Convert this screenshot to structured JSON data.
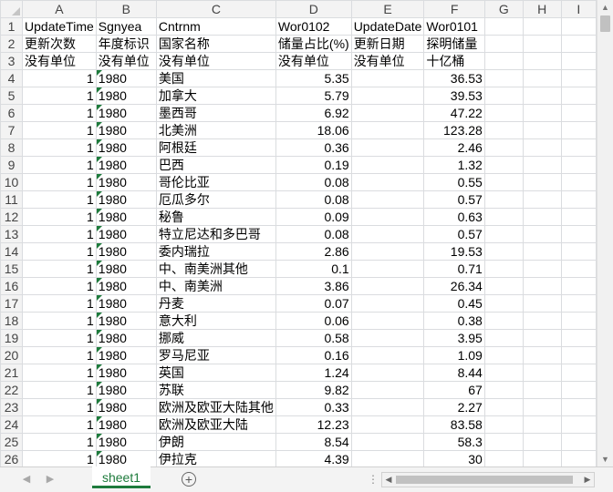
{
  "columns": [
    "A",
    "B",
    "C",
    "D",
    "E",
    "F",
    "G",
    "H",
    "I"
  ],
  "rows": [
    {
      "num": "1",
      "a": "UpdateTime",
      "b": "Sgnyea",
      "c": "Cntrnm",
      "d": "Wor0102",
      "e": "UpdateDate",
      "f": "Wor0101"
    },
    {
      "num": "2",
      "a": "更新次数",
      "b": "年度标识",
      "c": "国家名称",
      "d": "储量占比(%)",
      "e": "更新日期",
      "f": "探明储量"
    },
    {
      "num": "3",
      "a": "没有单位",
      "b": "没有单位",
      "c": "没有单位",
      "d": "没有单位",
      "e": "没有单位",
      "f": "十亿桶"
    },
    {
      "num": "4",
      "a": "1",
      "b": "1980",
      "c": "美国",
      "d": "5.35",
      "e": "",
      "f": "36.53"
    },
    {
      "num": "5",
      "a": "1",
      "b": "1980",
      "c": "加拿大",
      "d": "5.79",
      "e": "",
      "f": "39.53"
    },
    {
      "num": "6",
      "a": "1",
      "b": "1980",
      "c": "墨西哥",
      "d": "6.92",
      "e": "",
      "f": "47.22"
    },
    {
      "num": "7",
      "a": "1",
      "b": "1980",
      "c": "北美洲",
      "d": "18.06",
      "e": "",
      "f": "123.28"
    },
    {
      "num": "8",
      "a": "1",
      "b": "1980",
      "c": "阿根廷",
      "d": "0.36",
      "e": "",
      "f": "2.46"
    },
    {
      "num": "9",
      "a": "1",
      "b": "1980",
      "c": "巴西",
      "d": "0.19",
      "e": "",
      "f": "1.32"
    },
    {
      "num": "10",
      "a": "1",
      "b": "1980",
      "c": "哥伦比亚",
      "d": "0.08",
      "e": "",
      "f": "0.55"
    },
    {
      "num": "11",
      "a": "1",
      "b": "1980",
      "c": "厄瓜多尔",
      "d": "0.08",
      "e": "",
      "f": "0.57"
    },
    {
      "num": "12",
      "a": "1",
      "b": "1980",
      "c": "秘鲁",
      "d": "0.09",
      "e": "",
      "f": "0.63"
    },
    {
      "num": "13",
      "a": "1",
      "b": "1980",
      "c": "特立尼达和多巴哥",
      "d": "0.08",
      "e": "",
      "f": "0.57"
    },
    {
      "num": "14",
      "a": "1",
      "b": "1980",
      "c": "委内瑞拉",
      "d": "2.86",
      "e": "",
      "f": "19.53"
    },
    {
      "num": "15",
      "a": "1",
      "b": "1980",
      "c": "中、南美洲其他",
      "d": "0.1",
      "e": "",
      "f": "0.71"
    },
    {
      "num": "16",
      "a": "1",
      "b": "1980",
      "c": "中、南美洲",
      "d": "3.86",
      "e": "",
      "f": "26.34"
    },
    {
      "num": "17",
      "a": "1",
      "b": "1980",
      "c": "丹麦",
      "d": "0.07",
      "e": "",
      "f": "0.45"
    },
    {
      "num": "18",
      "a": "1",
      "b": "1980",
      "c": "意大利",
      "d": "0.06",
      "e": "",
      "f": "0.38"
    },
    {
      "num": "19",
      "a": "1",
      "b": "1980",
      "c": "挪威",
      "d": "0.58",
      "e": "",
      "f": "3.95"
    },
    {
      "num": "20",
      "a": "1",
      "b": "1980",
      "c": "罗马尼亚",
      "d": "0.16",
      "e": "",
      "f": "1.09"
    },
    {
      "num": "21",
      "a": "1",
      "b": "1980",
      "c": "英国",
      "d": "1.24",
      "e": "",
      "f": "8.44"
    },
    {
      "num": "22",
      "a": "1",
      "b": "1980",
      "c": "苏联",
      "d": "9.82",
      "e": "",
      "f": "67"
    },
    {
      "num": "23",
      "a": "1",
      "b": "1980",
      "c": "欧洲及欧亚大陆其他",
      "d": "0.33",
      "e": "",
      "f": "2.27"
    },
    {
      "num": "24",
      "a": "1",
      "b": "1980",
      "c": "欧洲及欧亚大陆",
      "d": "12.23",
      "e": "",
      "f": "83.58"
    },
    {
      "num": "25",
      "a": "1",
      "b": "1980",
      "c": "伊朗",
      "d": "8.54",
      "e": "",
      "f": "58.3"
    },
    {
      "num": "26",
      "a": "1",
      "b": "1980",
      "c": "伊拉克",
      "d": "4.39",
      "e": "",
      "f": "30"
    }
  ],
  "sheet_tab": "sheet1",
  "icons": {
    "add_sheet": "plus-circle-icon",
    "prev_sheet": "chevron-left-icon",
    "next_sheet": "chevron-right-icon",
    "more_tabs": "ellipsis-icon"
  },
  "colors": {
    "accent": "#1e7b3c",
    "header_bg": "#f3f3f3",
    "grid": "#dadcdf"
  }
}
